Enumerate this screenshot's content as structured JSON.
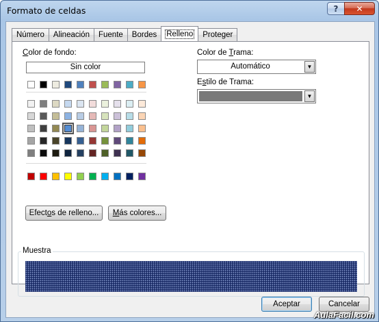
{
  "window": {
    "title": "Formato de celdas",
    "help_label": "?",
    "close_label": "✕"
  },
  "tabs": [
    {
      "label": "Número"
    },
    {
      "label": "Alineación"
    },
    {
      "label": "Fuente"
    },
    {
      "label": "Bordes"
    },
    {
      "label": "Relleno",
      "active": true
    },
    {
      "label": "Proteger"
    }
  ],
  "fill": {
    "background_color_label": "Color de fondo:",
    "no_color_label": "Sin color",
    "selected_swatch": "row 3, column 4",
    "palette": {
      "top_row": [
        "#ffffff",
        "#000000",
        "#eeece1",
        "#1f497d",
        "#4f81bd",
        "#c0504d",
        "#9bbb59",
        "#8064a2",
        "#4bacc6",
        "#f79646"
      ],
      "theme_rows": [
        [
          "#f2f2f2",
          "#7f7f7f",
          "#ddd9c3",
          "#c6d9f0",
          "#dbe5f1",
          "#f2dcdb",
          "#ebf1dd",
          "#e5e0ec",
          "#dbeef3",
          "#fdeada"
        ],
        [
          "#d8d8d8",
          "#595959",
          "#c4bd97",
          "#8db3e2",
          "#b8cce4",
          "#e5b9b7",
          "#d7e3bc",
          "#ccc1d9",
          "#b7dde8",
          "#fbd5b5"
        ],
        [
          "#bfbfbf",
          "#3f3f3f",
          "#938953",
          "#548dd4",
          "#95b3d7",
          "#d99694",
          "#c3d69b",
          "#b2a2c7",
          "#92cddc",
          "#fac08f"
        ],
        [
          "#a5a5a5",
          "#262626",
          "#494429",
          "#17365d",
          "#366092",
          "#953734",
          "#76923c",
          "#5f497a",
          "#31859b",
          "#e36c09"
        ],
        [
          "#7f7f7f",
          "#0c0c0c",
          "#1d1b10",
          "#0f243e",
          "#244061",
          "#632423",
          "#4f6128",
          "#3f3151",
          "#205867",
          "#974806"
        ]
      ],
      "standard_row": [
        "#c00000",
        "#ff0000",
        "#ffc000",
        "#ffff00",
        "#92d050",
        "#00b050",
        "#00b0f0",
        "#0070c0",
        "#002060",
        "#7030a0"
      ]
    },
    "fill_effects_label": "Efectos de relleno...",
    "more_colors_label": "Más colores...",
    "pattern_color_label": "Color de Trama:",
    "pattern_color_value": "Automático",
    "pattern_style_label": "Estilo de Trama:",
    "sample_label": "Muestra",
    "sample_color": "#1d2e69"
  },
  "footer": {
    "ok_label": "Aceptar",
    "cancel_label": "Cancelar"
  },
  "watermark": "AulaFacil.com"
}
